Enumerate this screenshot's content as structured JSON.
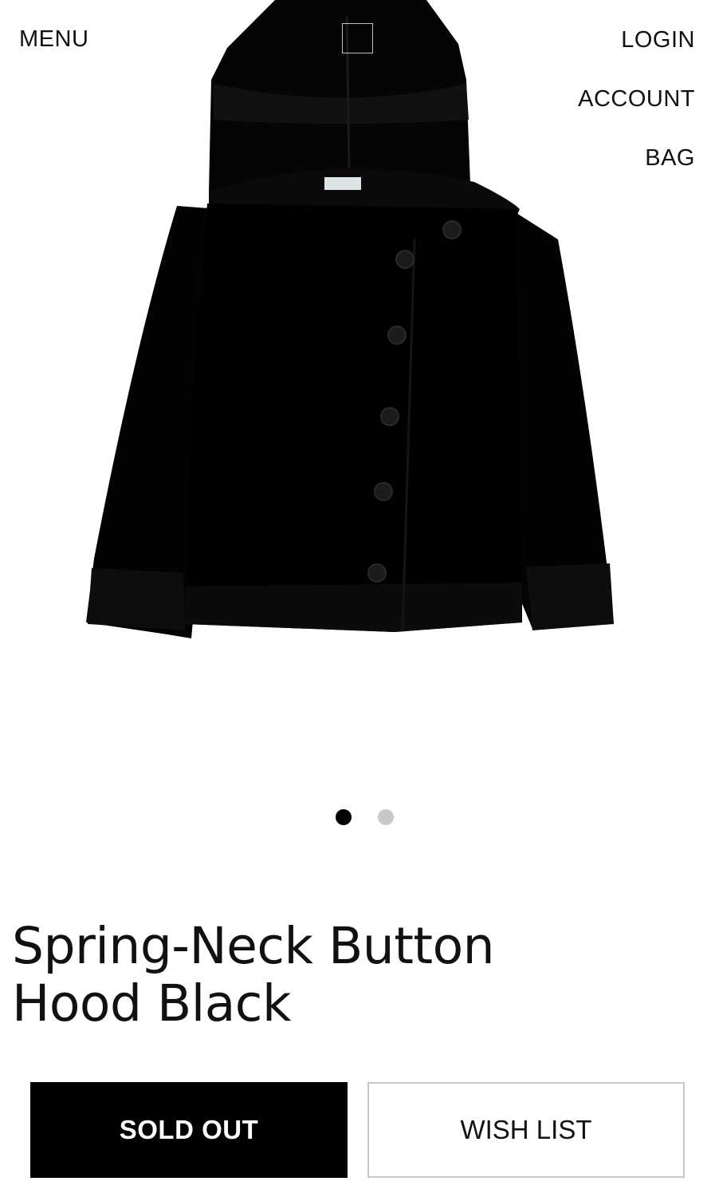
{
  "header": {
    "menu_label": "MENU",
    "login_label": "LOGIN",
    "account_label": "ACCOUNT",
    "bag_label": "BAG"
  },
  "product": {
    "image_icon": "hooded-jacket-photo",
    "title": "Spring-Neck Button Hood Black",
    "gallery": {
      "total": 2,
      "active_index": 0
    }
  },
  "actions": {
    "sold_out_label": "SOLD OUT",
    "wish_list_label": "WISH LIST"
  },
  "colors": {
    "accent": "#000000",
    "inactive_dot": "#c8c8c8",
    "background": "#ffffff"
  }
}
